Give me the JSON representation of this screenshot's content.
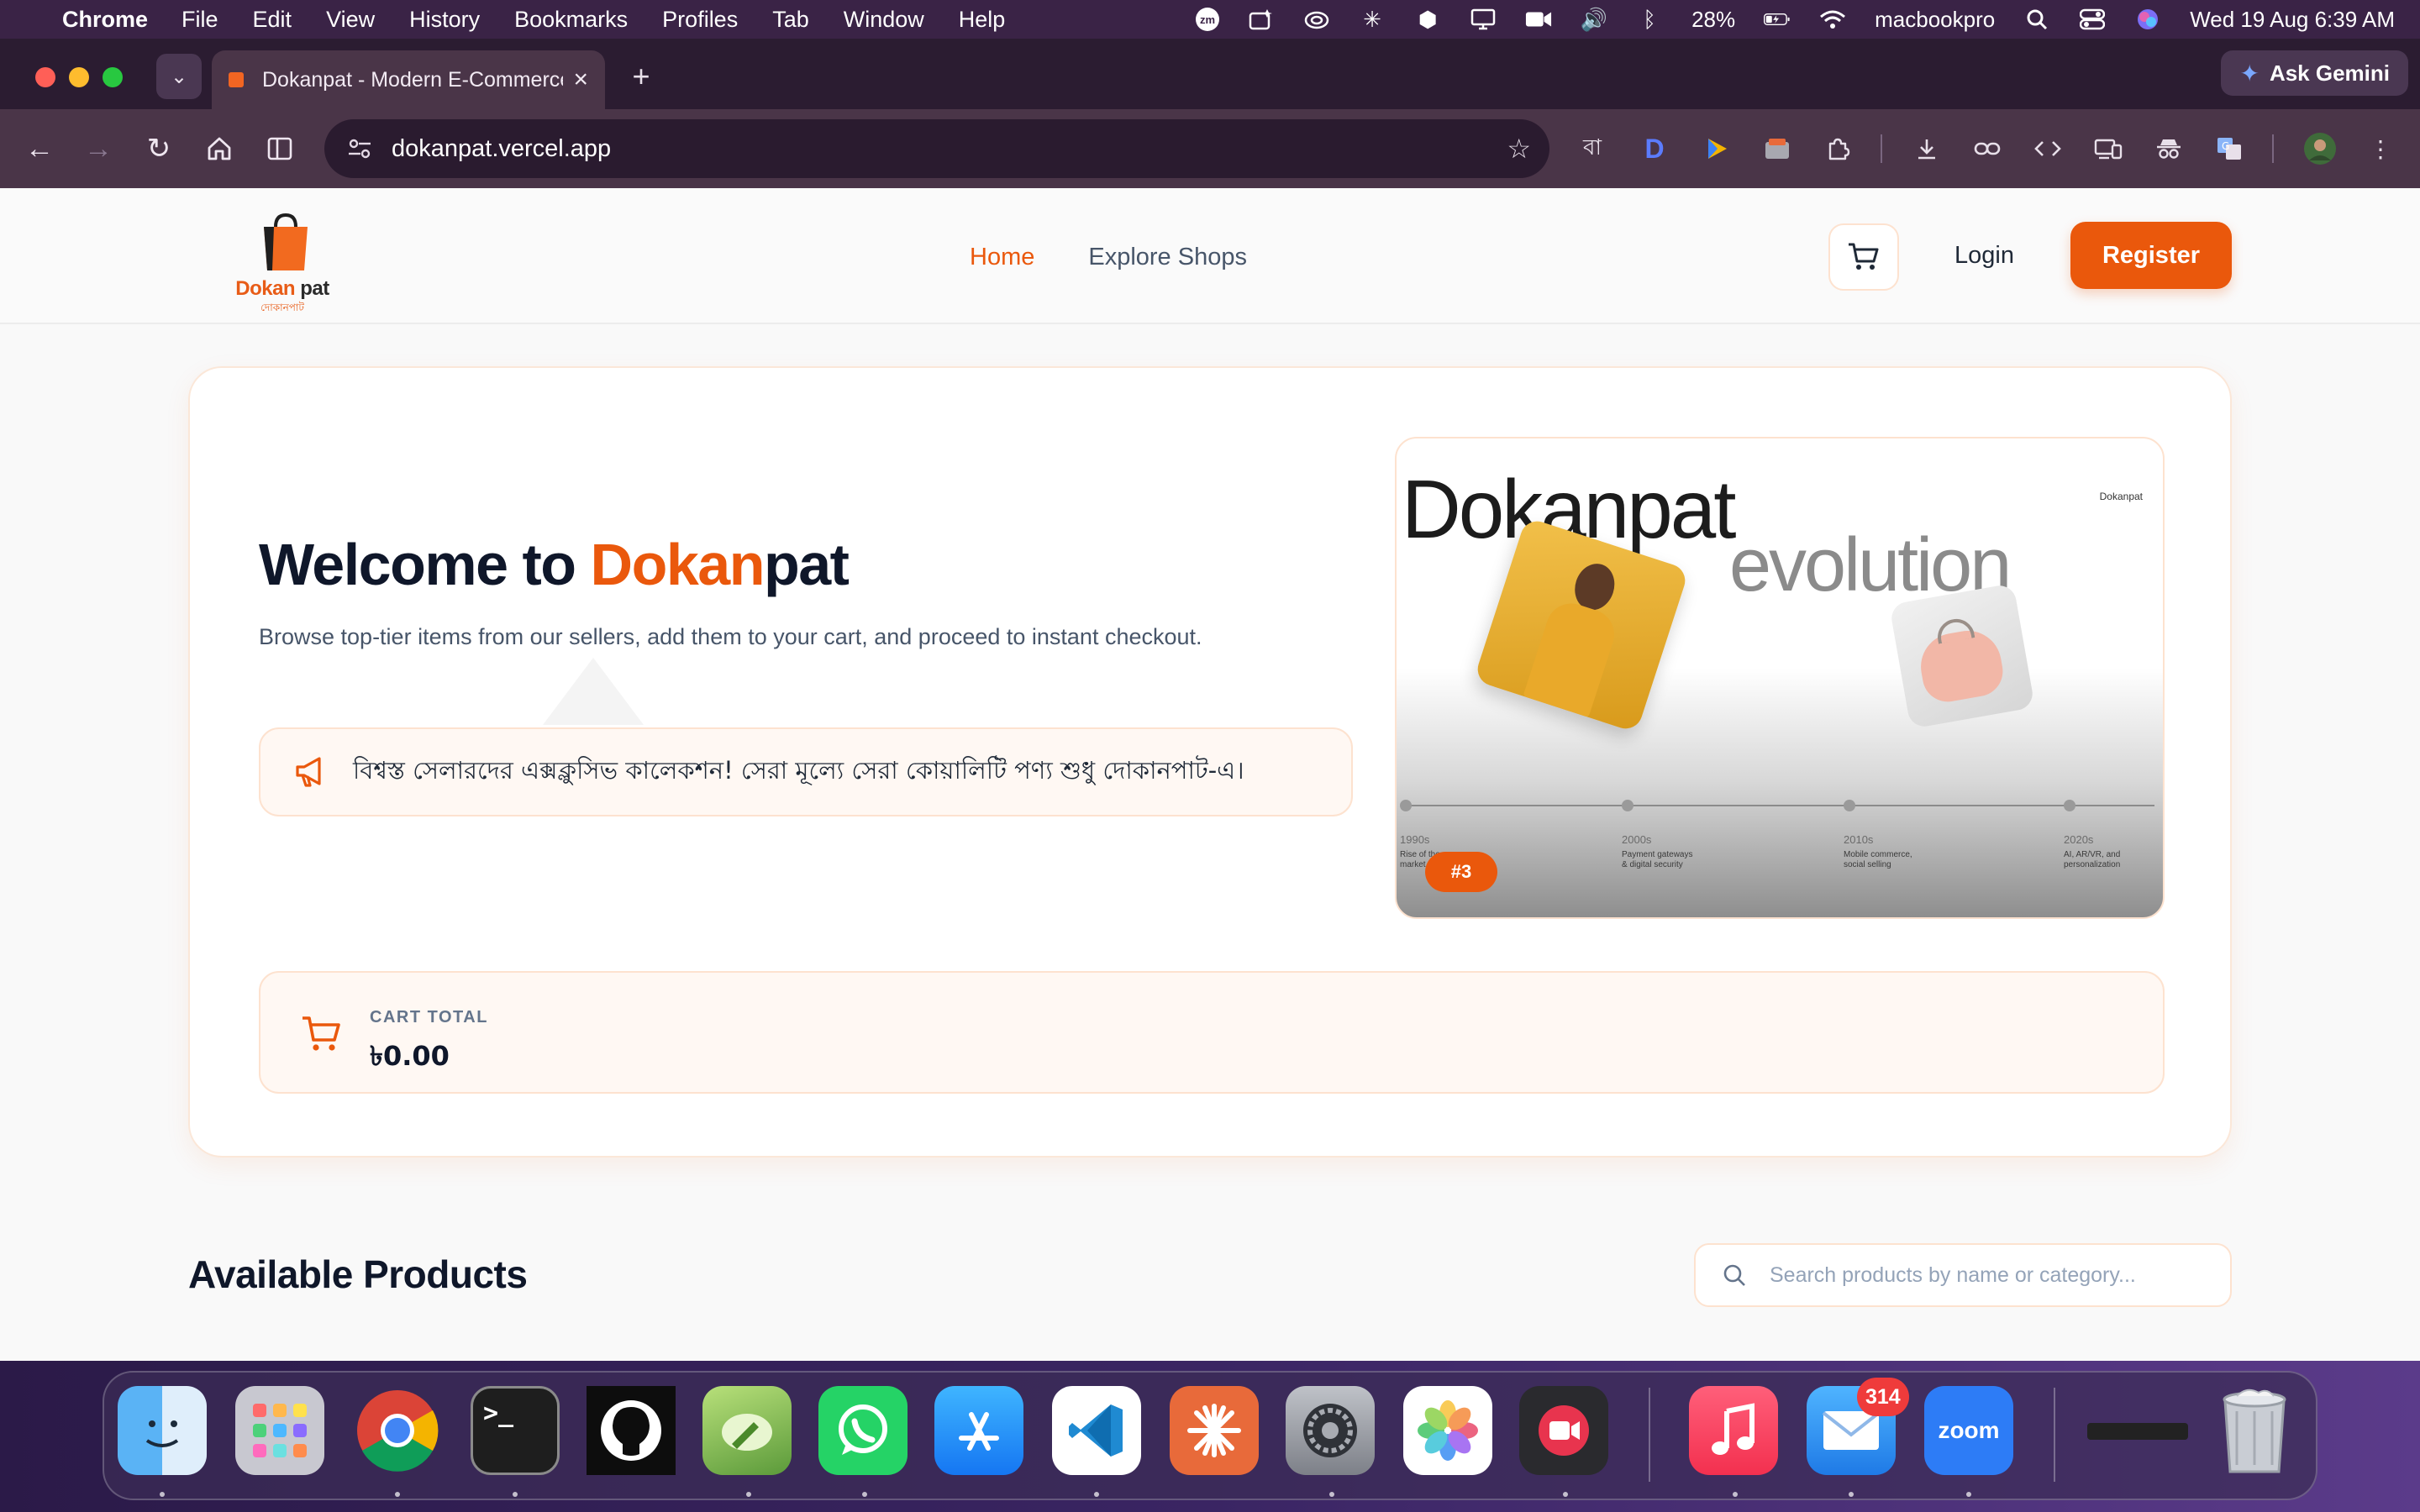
{
  "menubar": {
    "app_name": "Chrome",
    "items": [
      "File",
      "Edit",
      "View",
      "History",
      "Bookmarks",
      "Profiles",
      "Tab",
      "Window",
      "Help"
    ],
    "status": {
      "zoom_badge": "zm",
      "battery": "28%",
      "device_name": "macbookpro",
      "datetime": "Wed 19 Aug  6:39 AM"
    }
  },
  "browser": {
    "tab_title": "Dokanpat - Modern E-Commerce",
    "url": "dokanpat.vercel.app",
    "ask_gemini_label": "Ask Gemini",
    "extension_bangla": "বা",
    "extension_d": "D"
  },
  "site": {
    "logo": {
      "brand_orange": "Dokan",
      "brand_dark": "pat",
      "subtitle": "দোকানপাট"
    },
    "nav": {
      "home": "Home",
      "explore": "Explore Shops"
    },
    "login_label": "Login",
    "register_label": "Register",
    "hero": {
      "title_prefix": "Welcome to ",
      "title_brand_orange": "Dokan",
      "title_brand_dark": "pat",
      "description": "Browse top-tier items from our sellers, add them to your cart, and proceed to instant checkout.",
      "promo": "বিশ্বস্ত সেলারদের এক্সক্লুসিভ কালেকশন! সেরা মূল্যে সেরা কোয়ালিটি পণ্য শুধু দোকানপাট-এ।",
      "image": {
        "title_1": "Dokanpat",
        "title_2": "evolution",
        "corner_label": "Dokanpat",
        "timeline": [
          {
            "year": "1990s",
            "caption": "Rise of the\nmarket"
          },
          {
            "year": "2000s",
            "caption": "Payment gateways\n& digital security"
          },
          {
            "year": "2010s",
            "caption": "Mobile commerce,\nsocial selling"
          },
          {
            "year": "2020s",
            "caption": "AI, AR/VR, and\npersonalization"
          }
        ],
        "slide_badge": "#3"
      }
    },
    "cart_total": {
      "label": "CART TOTAL",
      "amount": "৳0.00"
    },
    "products": {
      "heading": "Available Products",
      "search_placeholder": "Search products by name or category..."
    },
    "colors": {
      "accent": "#ea580c",
      "heading": "#0f172a",
      "muted": "#475569"
    }
  },
  "dock": {
    "apps": [
      "Finder",
      "Launchpad",
      "Google Chrome",
      "Terminal",
      "GitHub Desktop",
      "Rocket Typist",
      "WhatsApp",
      "App Store",
      "Visual Studio Code",
      "Claude",
      "System Settings",
      "Photos",
      "Screen Recorder",
      "Music",
      "Mail",
      "Zoom",
      "Trash"
    ],
    "mail_badge": "314",
    "zoom_label": "zoom",
    "terminal_prompt": ">_"
  }
}
